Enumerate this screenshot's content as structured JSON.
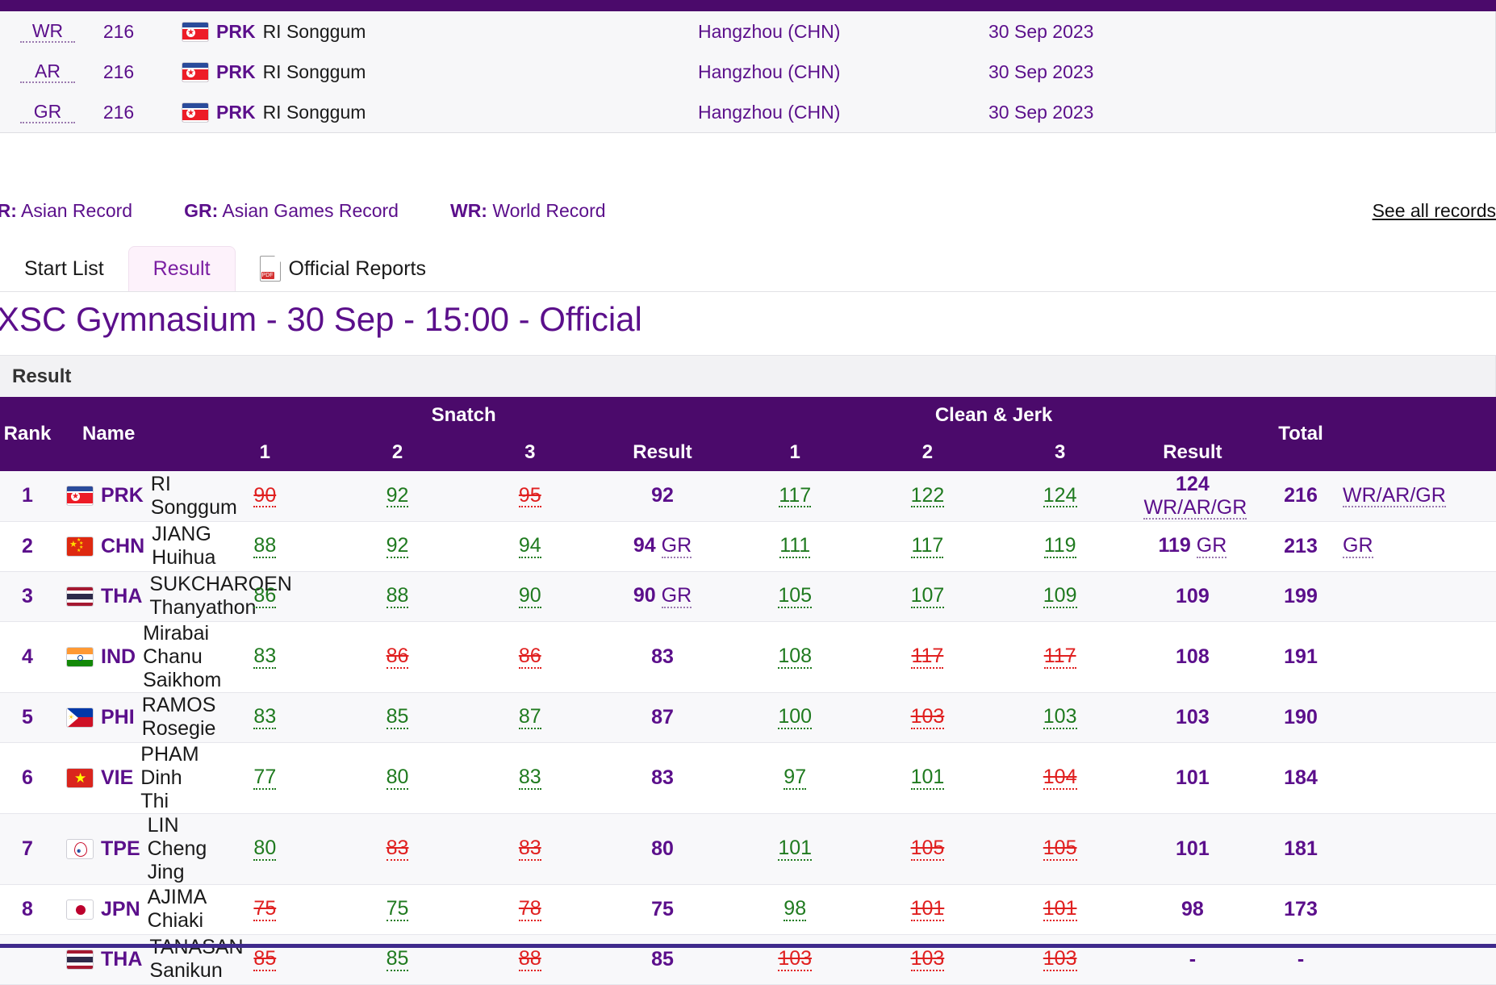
{
  "records": {
    "rows": [
      {
        "type": "WR",
        "value": "216",
        "noc": "PRK",
        "flag": "prk",
        "name": "RI Songgum",
        "venue": "Hangzhou (CHN)",
        "date": "30 Sep 2023"
      },
      {
        "type": "AR",
        "value": "216",
        "noc": "PRK",
        "flag": "prk",
        "name": "RI Songgum",
        "venue": "Hangzhou (CHN)",
        "date": "30 Sep 2023"
      },
      {
        "type": "GR",
        "value": "216",
        "noc": "PRK",
        "flag": "prk",
        "name": "RI Songgum",
        "venue": "Hangzhou (CHN)",
        "date": "30 Sep 2023"
      }
    ]
  },
  "legend": {
    "items": [
      {
        "abbr": "AR:",
        "text": " Asian Record"
      },
      {
        "abbr": "GR:",
        "text": " Asian Games Record"
      },
      {
        "abbr": "WR:",
        "text": " World Record"
      }
    ],
    "see_all_label": "See all records"
  },
  "tabs": [
    {
      "label": "Start List",
      "active": false,
      "icon": null
    },
    {
      "label": "Result",
      "active": true,
      "icon": null
    },
    {
      "label": "Official Reports",
      "active": false,
      "icon": "pdf-icon"
    }
  ],
  "session": {
    "title": "XSC Gymnasium - 30 Sep - 15:00 - Official"
  },
  "table": {
    "caption": "Result",
    "headers": {
      "rank": "Rank",
      "name": "Name",
      "snatch_group": "Snatch",
      "cleanjerk_group": "Clean & Jerk",
      "a1": "1",
      "a2": "2",
      "a3": "3",
      "snatch_result": "Result",
      "cj1": "1",
      "cj2": "2",
      "cj3": "3",
      "cj_result": "Result",
      "total": "Total"
    },
    "rows": [
      {
        "rank": "1",
        "flag": "prk",
        "noc": "PRK",
        "name": "RI Songgum",
        "snatch": [
          {
            "v": "90",
            "ok": false
          },
          {
            "v": "92",
            "ok": true
          },
          {
            "v": "95",
            "ok": false
          }
        ],
        "snatch_result": "92",
        "snatch_rec": "",
        "cj": [
          {
            "v": "117",
            "ok": true
          },
          {
            "v": "122",
            "ok": true
          },
          {
            "v": "124",
            "ok": true
          }
        ],
        "cj_result": "124",
        "cj_rec": "WR/AR/GR",
        "total": "216",
        "total_rec": "WR/AR/GR"
      },
      {
        "rank": "2",
        "flag": "chn",
        "noc": "CHN",
        "name": "JIANG Huihua",
        "snatch": [
          {
            "v": "88",
            "ok": true
          },
          {
            "v": "92",
            "ok": true
          },
          {
            "v": "94",
            "ok": true
          }
        ],
        "snatch_result": "94",
        "snatch_rec": "GR",
        "cj": [
          {
            "v": "111",
            "ok": true
          },
          {
            "v": "117",
            "ok": true
          },
          {
            "v": "119",
            "ok": true
          }
        ],
        "cj_result": "119",
        "cj_rec": "GR",
        "total": "213",
        "total_rec": "GR"
      },
      {
        "rank": "3",
        "flag": "tha",
        "noc": "THA",
        "name": "SUKCHAROEN Thanyathon",
        "snatch": [
          {
            "v": "86",
            "ok": true
          },
          {
            "v": "88",
            "ok": true
          },
          {
            "v": "90",
            "ok": true
          }
        ],
        "snatch_result": "90",
        "snatch_rec": "GR",
        "cj": [
          {
            "v": "105",
            "ok": true
          },
          {
            "v": "107",
            "ok": true
          },
          {
            "v": "109",
            "ok": true
          }
        ],
        "cj_result": "109",
        "cj_rec": "",
        "total": "199",
        "total_rec": ""
      },
      {
        "rank": "4",
        "flag": "ind",
        "noc": "IND",
        "name": "Mirabai Chanu Saikhom",
        "snatch": [
          {
            "v": "83",
            "ok": true
          },
          {
            "v": "86",
            "ok": false
          },
          {
            "v": "86",
            "ok": false
          }
        ],
        "snatch_result": "83",
        "snatch_rec": "",
        "cj": [
          {
            "v": "108",
            "ok": true
          },
          {
            "v": "117",
            "ok": false
          },
          {
            "v": "117",
            "ok": false
          }
        ],
        "cj_result": "108",
        "cj_rec": "",
        "total": "191",
        "total_rec": ""
      },
      {
        "rank": "5",
        "flag": "phi",
        "noc": "PHI",
        "name": "RAMOS Rosegie",
        "snatch": [
          {
            "v": "83",
            "ok": true
          },
          {
            "v": "85",
            "ok": true
          },
          {
            "v": "87",
            "ok": true
          }
        ],
        "snatch_result": "87",
        "snatch_rec": "",
        "cj": [
          {
            "v": "100",
            "ok": true
          },
          {
            "v": "103",
            "ok": false
          },
          {
            "v": "103",
            "ok": true
          }
        ],
        "cj_result": "103",
        "cj_rec": "",
        "total": "190",
        "total_rec": ""
      },
      {
        "rank": "6",
        "flag": "vie",
        "noc": "VIE",
        "name": "PHAM Dinh Thi",
        "snatch": [
          {
            "v": "77",
            "ok": true
          },
          {
            "v": "80",
            "ok": true
          },
          {
            "v": "83",
            "ok": true
          }
        ],
        "snatch_result": "83",
        "snatch_rec": "",
        "cj": [
          {
            "v": "97",
            "ok": true
          },
          {
            "v": "101",
            "ok": true
          },
          {
            "v": "104",
            "ok": false
          }
        ],
        "cj_result": "101",
        "cj_rec": "",
        "total": "184",
        "total_rec": ""
      },
      {
        "rank": "7",
        "flag": "tpe",
        "noc": "TPE",
        "name": "LIN Cheng Jing",
        "snatch": [
          {
            "v": "80",
            "ok": true
          },
          {
            "v": "83",
            "ok": false
          },
          {
            "v": "83",
            "ok": false
          }
        ],
        "snatch_result": "80",
        "snatch_rec": "",
        "cj": [
          {
            "v": "101",
            "ok": true
          },
          {
            "v": "105",
            "ok": false
          },
          {
            "v": "105",
            "ok": false
          }
        ],
        "cj_result": "101",
        "cj_rec": "",
        "total": "181",
        "total_rec": ""
      },
      {
        "rank": "8",
        "flag": "jpn",
        "noc": "JPN",
        "name": "AJIMA Chiaki",
        "snatch": [
          {
            "v": "75",
            "ok": false
          },
          {
            "v": "75",
            "ok": true
          },
          {
            "v": "78",
            "ok": false
          }
        ],
        "snatch_result": "75",
        "snatch_rec": "",
        "cj": [
          {
            "v": "98",
            "ok": true
          },
          {
            "v": "101",
            "ok": false
          },
          {
            "v": "101",
            "ok": false
          }
        ],
        "cj_result": "98",
        "cj_rec": "",
        "total": "173",
        "total_rec": ""
      },
      {
        "rank": "",
        "flag": "tha",
        "noc": "THA",
        "name": "TANASAN Sanikun",
        "snatch": [
          {
            "v": "85",
            "ok": false
          },
          {
            "v": "85",
            "ok": true
          },
          {
            "v": "88",
            "ok": false
          }
        ],
        "snatch_result": "85",
        "snatch_rec": "",
        "cj": [
          {
            "v": "103",
            "ok": false
          },
          {
            "v": "103",
            "ok": false
          },
          {
            "v": "103",
            "ok": false
          }
        ],
        "cj_result": "-",
        "cj_rec": "",
        "total": "-",
        "total_rec": ""
      }
    ]
  },
  "colors": {
    "brand_purple": "#4b0a6b",
    "text_purple": "#5b0f8b",
    "good_green": "#1f7a1f",
    "bad_red": "#e02020",
    "active_tab_bg": "#fdf2fb"
  }
}
